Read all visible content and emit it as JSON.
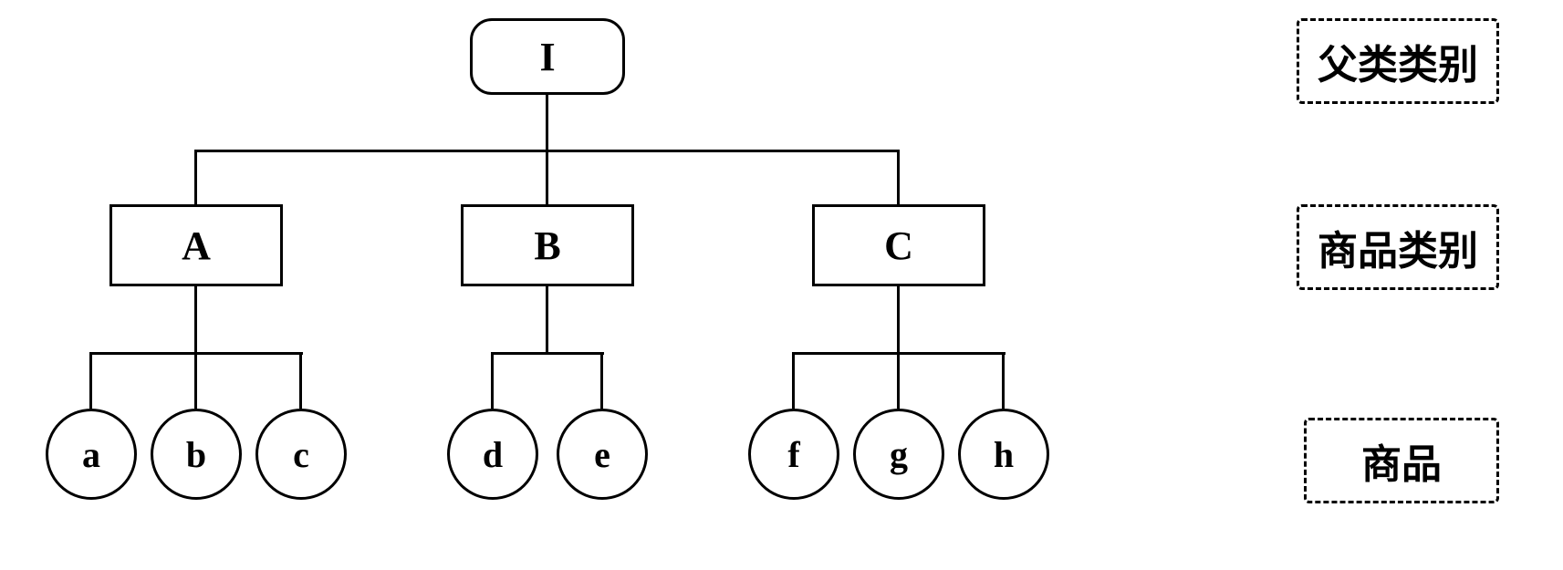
{
  "chart_data": {
    "type": "tree",
    "root": {
      "id": "I",
      "label": "I",
      "shape": "rounded-rect"
    },
    "level2": [
      {
        "id": "A",
        "label": "A",
        "shape": "rect",
        "children": [
          "a",
          "b",
          "c"
        ]
      },
      {
        "id": "B",
        "label": "B",
        "shape": "rect",
        "children": [
          "d",
          "e"
        ]
      },
      {
        "id": "C",
        "label": "C",
        "shape": "rect",
        "children": [
          "f",
          "g",
          "h"
        ]
      }
    ],
    "level3": [
      {
        "id": "a",
        "label": "a",
        "shape": "circle"
      },
      {
        "id": "b",
        "label": "b",
        "shape": "circle"
      },
      {
        "id": "c",
        "label": "c",
        "shape": "circle"
      },
      {
        "id": "d",
        "label": "d",
        "shape": "circle"
      },
      {
        "id": "e",
        "label": "e",
        "shape": "circle"
      },
      {
        "id": "f",
        "label": "f",
        "shape": "circle"
      },
      {
        "id": "g",
        "label": "g",
        "shape": "circle"
      },
      {
        "id": "h",
        "label": "h",
        "shape": "circle"
      }
    ],
    "level_labels": {
      "level1": "父类类别",
      "level2": "商品类别",
      "level3": "商品"
    }
  },
  "root_label": "I",
  "cat": {
    "a": "A",
    "b": "B",
    "c": "C"
  },
  "item": {
    "a": "a",
    "b": "b",
    "c": "c",
    "d": "d",
    "e": "e",
    "f": "f",
    "g": "g",
    "h": "h"
  },
  "label": {
    "parent_category": "父类类别",
    "product_category": "商品类别",
    "product": "商品"
  }
}
